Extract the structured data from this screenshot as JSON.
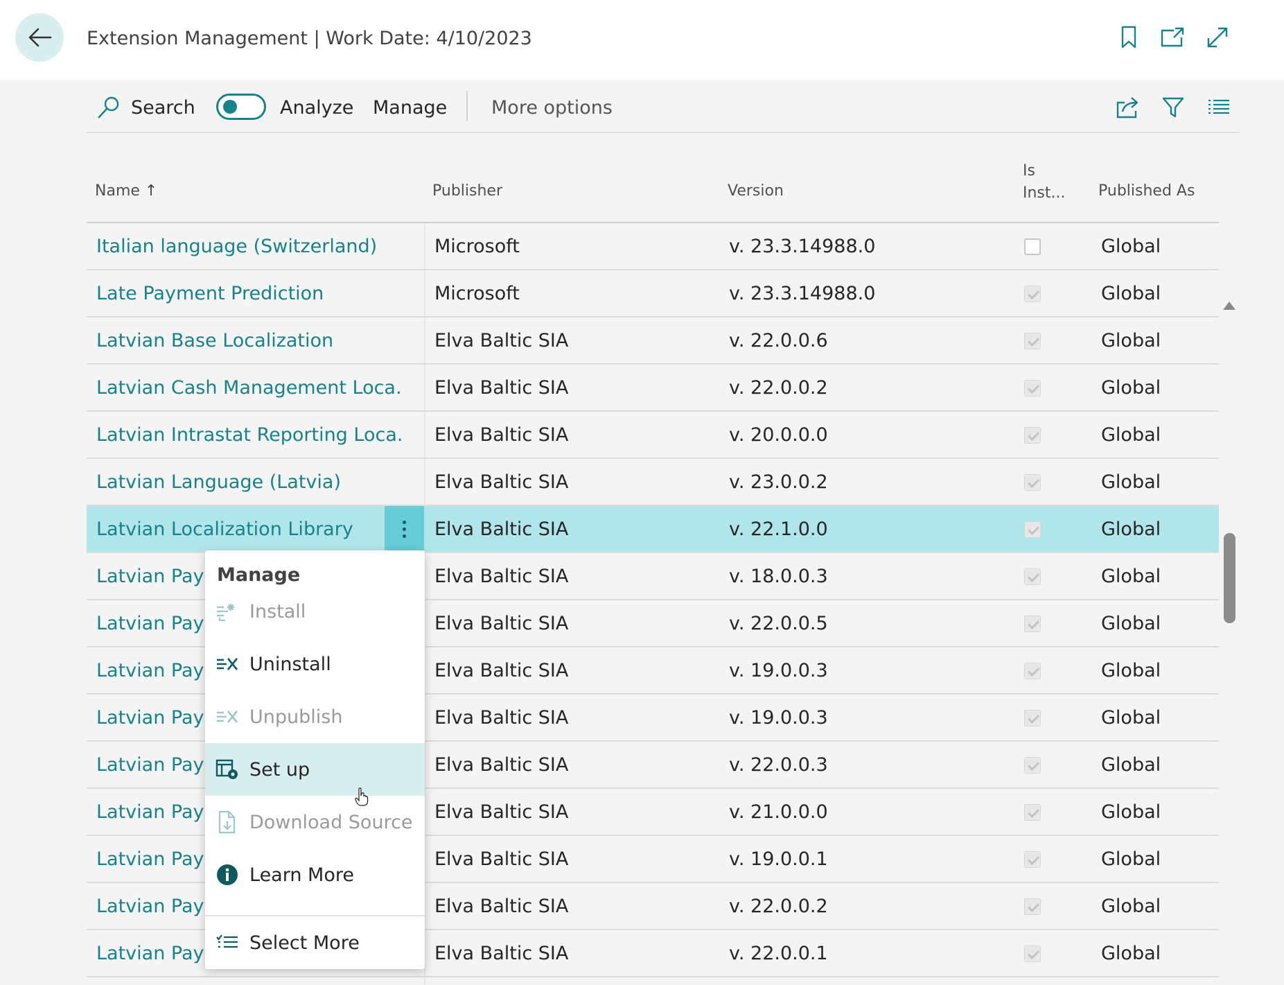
{
  "header": {
    "title": "Extension Management | Work Date: 4/10/2023",
    "icons": [
      "back-arrow-icon",
      "bookmark-icon",
      "open-new-window-icon",
      "expand-icon"
    ]
  },
  "toolbar": {
    "search_label": "Search",
    "analyze_label": "Analyze",
    "analyze_on": false,
    "manage_label": "Manage",
    "more_options_label": "More options",
    "icons": [
      "share-icon",
      "filter-icon",
      "list-view-icon"
    ]
  },
  "columns": {
    "name": "Name",
    "name_sort": "↑",
    "publisher": "Publisher",
    "version": "Version",
    "is_installed_line1": "Is",
    "is_installed_line2": "Inst...",
    "published_as": "Published As"
  },
  "rows": [
    {
      "name": "Italian language (Switzerland)",
      "publisher": "Microsoft",
      "version": "v. 23.3.14988.0",
      "installed": false,
      "published_as": "Global"
    },
    {
      "name": "Late Payment Prediction",
      "publisher": "Microsoft",
      "version": "v. 23.3.14988.0",
      "installed": true,
      "published_as": "Global"
    },
    {
      "name": "Latvian Base Localization",
      "publisher": "Elva Baltic SIA",
      "version": "v. 22.0.0.6",
      "installed": true,
      "published_as": "Global"
    },
    {
      "name": "Latvian Cash Management Loca...",
      "publisher": "Elva Baltic SIA",
      "version": "v. 22.0.0.2",
      "installed": true,
      "published_as": "Global"
    },
    {
      "name": "Latvian Intrastat Reporting Loca...",
      "publisher": "Elva Baltic SIA",
      "version": "v. 20.0.0.0",
      "installed": true,
      "published_as": "Global"
    },
    {
      "name": "Latvian Language (Latvia)",
      "publisher": "Elva Baltic SIA",
      "version": "v. 23.0.0.2",
      "installed": true,
      "published_as": "Global"
    },
    {
      "name": "Latvian Localization Library",
      "publisher": "Elva Baltic SIA",
      "version": "v. 22.1.0.0",
      "installed": true,
      "published_as": "Global",
      "selected": true
    },
    {
      "name": "Latvian Payro",
      "publisher": "Elva Baltic SIA",
      "version": "v. 18.0.0.3",
      "installed": true,
      "published_as": "Global"
    },
    {
      "name": "Latvian Payro",
      "publisher": "Elva Baltic SIA",
      "version": "v. 22.0.0.5",
      "installed": true,
      "published_as": "Global"
    },
    {
      "name": "Latvian Payro",
      "publisher": "Elva Baltic SIA",
      "version": "v. 19.0.0.3",
      "installed": true,
      "published_as": "Global"
    },
    {
      "name": "Latvian Payro",
      "publisher": "Elva Baltic SIA",
      "version": "v. 19.0.0.3",
      "installed": true,
      "published_as": "Global"
    },
    {
      "name": "Latvian Payro",
      "publisher": "Elva Baltic SIA",
      "version": "v. 22.0.0.3",
      "installed": true,
      "published_as": "Global"
    },
    {
      "name": "Latvian Payro",
      "publisher": "Elva Baltic SIA",
      "version": "v. 21.0.0.0",
      "installed": true,
      "published_as": "Global"
    },
    {
      "name": "Latvian Payro",
      "publisher": "Elva Baltic SIA",
      "version": "v. 19.0.0.1",
      "installed": true,
      "published_as": "Global"
    },
    {
      "name": "Latvian Payro",
      "publisher": "Elva Baltic SIA",
      "version": "v. 22.0.0.2",
      "installed": true,
      "published_as": "Global"
    },
    {
      "name": "Latvian Payro",
      "publisher": "Elva Baltic SIA",
      "version": "v. 22.0.0.1",
      "installed": true,
      "published_as": "Global"
    }
  ],
  "context_menu": {
    "title": "Manage",
    "items": [
      {
        "label": "Install",
        "icon": "install-icon",
        "disabled": true
      },
      {
        "label": "Uninstall",
        "icon": "uninstall-icon",
        "disabled": false
      },
      {
        "label": "Unpublish",
        "icon": "unpublish-icon",
        "disabled": true
      },
      {
        "label": "Set up",
        "icon": "setup-icon",
        "disabled": false,
        "hover": true
      },
      {
        "label": "Download Source",
        "icon": "download-source-icon",
        "disabled": true
      },
      {
        "label": "Learn More",
        "icon": "info-icon",
        "disabled": false
      },
      {
        "label": "Select More",
        "icon": "select-more-icon",
        "disabled": false
      }
    ]
  },
  "colors": {
    "accent": "#17828c",
    "selected_row": "#b0e6ea",
    "row_menu_button": "#66cdd6",
    "menu_hover": "#d9eef0"
  }
}
